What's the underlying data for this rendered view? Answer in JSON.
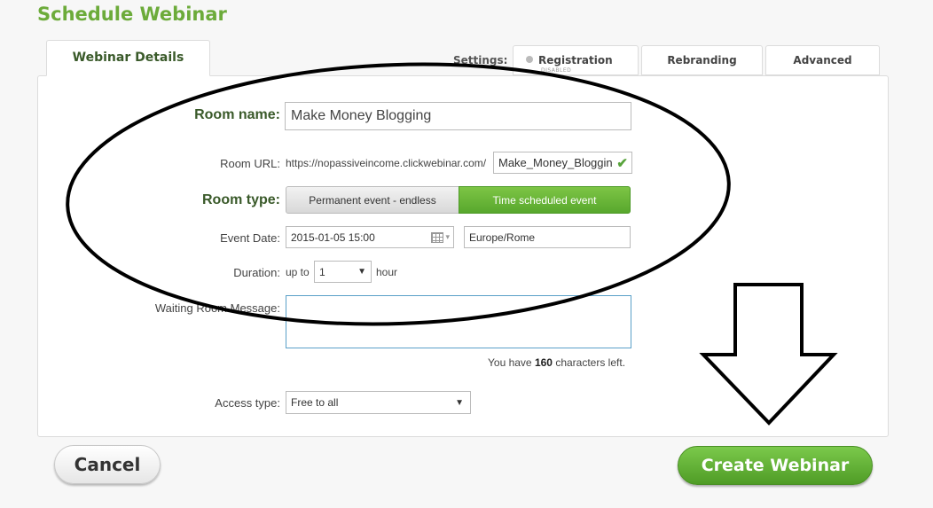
{
  "page": {
    "title": "Schedule Webinar"
  },
  "tabs": {
    "details": "Webinar Details",
    "settings_label": "Settings:",
    "registration": "Registration",
    "registration_status": "DISABLED",
    "rebranding": "Rebranding",
    "advanced": "Advanced"
  },
  "form": {
    "room_name": {
      "label": "Room name:",
      "value": "Make Money Blogging"
    },
    "room_url": {
      "label": "Room URL:",
      "prefix": "https://nopassiveincome.clickwebinar.com/",
      "value": "Make_Money_Bloggin"
    },
    "room_type": {
      "label": "Room type:",
      "options": [
        "Permanent event - endless",
        "Time scheduled event"
      ],
      "selected": "Time scheduled event"
    },
    "event_date": {
      "label": "Event Date:",
      "value": "2015-01-05 15:00",
      "timezone": "Europe/Rome"
    },
    "duration": {
      "label": "Duration:",
      "prefix": "up to",
      "value": "1",
      "unit": "hour"
    },
    "waiting_room": {
      "label": "Waiting Room Message:",
      "value": "",
      "chars_prefix": "You have",
      "chars_left": "160",
      "chars_suffix": "characters left."
    },
    "access_type": {
      "label": "Access type:",
      "value": "Free to all"
    }
  },
  "actions": {
    "cancel": "Cancel",
    "create": "Create Webinar"
  },
  "colors": {
    "accent": "#6cab3a",
    "button_green": "#5aa82f"
  },
  "icons": [
    "calendar-icon",
    "checkmark-icon",
    "dropdown-caret-icon",
    "status-dot-icon"
  ]
}
